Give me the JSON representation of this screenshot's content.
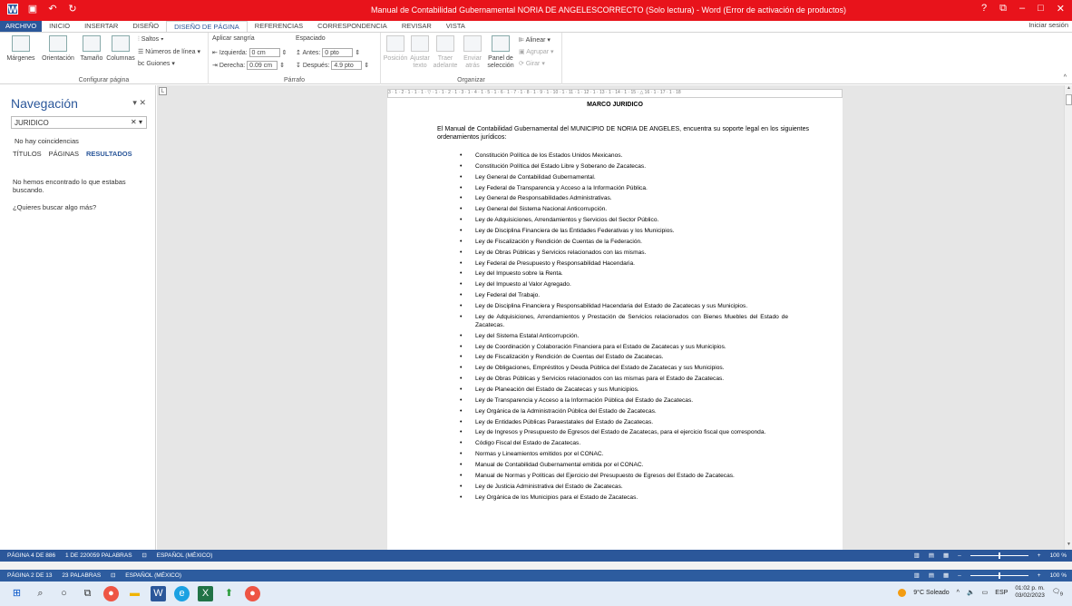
{
  "titlebar": {
    "title": "Manual de Contabilidad Gubernamental NORIA DE ANGELESCORRECTO (Solo lectura) - Word (Error de activación de productos)",
    "controls": [
      "?",
      "⧉",
      "–",
      "□",
      "✕"
    ]
  },
  "tabs": {
    "file": "ARCHIVO",
    "items": [
      "INICIO",
      "INSERTAR",
      "DISEÑO",
      "DISEÑO DE PÁGINA",
      "REFERENCIAS",
      "CORRESPONDENCIA",
      "REVISAR",
      "VISTA"
    ],
    "signin": "Iniciar sesión"
  },
  "ribbon": {
    "setup": {
      "margins": "Márgenes",
      "orientation": "Orientación",
      "size": "Tamaño",
      "columns": "Columnas",
      "breaks": "Saltos",
      "line_numbers": "Números de línea",
      "hyphenation": "Guiones",
      "label": "Configurar página"
    },
    "paragraph": {
      "indent_title": "Aplicar sangría",
      "spacing_title": "Espaciado",
      "left_label": "Izquierda:",
      "left_value": "0 cm",
      "right_label": "Derecha:",
      "right_value": "0.09 cm",
      "before_label": "Antes:",
      "before_value": "0 pto",
      "after_label": "Después:",
      "after_value": "4.9 pto",
      "label": "Párrafo"
    },
    "arrange": {
      "position": "Posición",
      "wrap": "Ajustar texto",
      "forward": "Traer adelante",
      "backward": "Enviar atrás",
      "selection": "Panel de selección",
      "align": "Alinear",
      "group": "Agrupar",
      "rotate": "Girar",
      "label": "Organizar"
    }
  },
  "nav": {
    "title": "Navegación",
    "search_value": "JURIDICO",
    "no_match": "No hay coincidencias",
    "tabs": [
      "TÍTULOS",
      "PÁGINAS",
      "RESULTADOS"
    ],
    "message": "No hemos encontrado lo que estabas buscando.",
    "more": "¿Quieres buscar algo más?"
  },
  "ruler": "3 · 1 · 2 · 1 · 1 · 1 · ▽ · 1 · 1 · 2 · 1 · 3 · 1 · 4 · 1 · 5 · 1 · 6 · 1 · 7 · 1 · 8 · 1 · 9 · 1 · 10 · 1 · 11 · 1 · 12 · 1 · 13 · 1 · 14 · 1 · 15 · △ 16 · 1 · 17 · 1 · 18",
  "document": {
    "heading": "MARCO JURIDICO",
    "intro": "El Manual de Contabilidad Gubernamental del MUNICIPIO DE NORIA DE ANGELES, encuentra su soporte legal en los siguientes ordenamientos jurídicos:",
    "items": [
      "Constitución Política de los Estados Unidos Mexicanos.",
      "Constitución Política del Estado Libre y Soberano de Zacatecas.",
      "Ley General de Contabilidad Gubernamental.",
      "Ley Federal de Transparencia y Acceso a la Información Pública.",
      "Ley General de Responsabilidades Administrativas.",
      "Ley General del Sistema Nacional Anticorrupción.",
      "Ley de Adquisiciones, Arrendamientos y Servicios del Sector Público.",
      "Ley de Disciplina Financiera de las Entidades Federativas y los Municipios.",
      "Ley de Fiscalización y Rendición de Cuentas de la Federación.",
      "Ley de Obras Públicas y Servicios relacionados con las mismas.",
      "Ley Federal de Presupuesto y Responsabilidad Hacendaria.",
      "Ley del Impuesto sobre la Renta.",
      "Ley del Impuesto al Valor Agregado.",
      "Ley Federal del Trabajo.",
      "Ley de Disciplina Financiera y Responsabilidad Hacendaria del Estado de Zacatecas y sus Municipios.",
      "Ley de Adquisiciones, Arrendamientos y Prestación de Servicios relacionados con Bienes Muebles del Estado de Zacatecas.",
      "Ley del Sistema Estatal Anticorrupción.",
      "Ley de Coordinación y Colaboración Financiera para el Estado de Zacatecas y sus Municipios.",
      "Ley de Fiscalización y Rendición de Cuentas del Estado de Zacatecas.",
      "Ley de Obligaciones, Empréstitos y Deuda Pública del Estado de Zacatecas y sus Municipios.",
      "Ley de Obras Públicas y Servicios relacionados con las mismas para el Estado de Zacatecas.",
      "Ley de Planeación del Estado de Zacatecas y sus Municipios.",
      "Ley de Transparencia y Acceso a la Información Pública del Estado de Zacatecas.",
      "Ley Orgánica de la Administración Pública del Estado de Zacatecas.",
      "Ley de Entidades Públicas Paraestatales del Estado de Zacatecas.",
      "Ley de Ingresos y Presupuesto de Egresos del Estado de Zacatecas, para el ejercicio fiscal que corresponda.",
      "Código Fiscal del Estado de Zacatecas.",
      "Normas y Lineamientos emitidos por el CONAC.",
      "Manual de Contabilidad Gubernamental emitida por el CONAC.",
      "Manual de Normas y Políticas del Ejercicio del Presupuesto de Egresos del Estado de Zacatecas.",
      "Ley de Justicia Administrativa del Estado de Zacatecas.",
      "Ley Orgánica de los Municipios para el Estado de Zacatecas."
    ]
  },
  "status1": {
    "page": "PÁGINA 4 DE 886",
    "words": "1 DE 220059 PALABRAS",
    "language": "ESPAÑOL (MÉXICO)",
    "zoom": "100 %"
  },
  "status2": {
    "page": "PÁGINA 2 DE 13",
    "words": "23 PALABRAS",
    "language": "ESPAÑOL (MÉXICO)",
    "zoom": "100 %"
  },
  "taskbar": {
    "weather": "9°C Soleado",
    "lang": "ESP",
    "time": "01:02 p. m.",
    "date": "03/02/2023",
    "notifications": "9"
  }
}
